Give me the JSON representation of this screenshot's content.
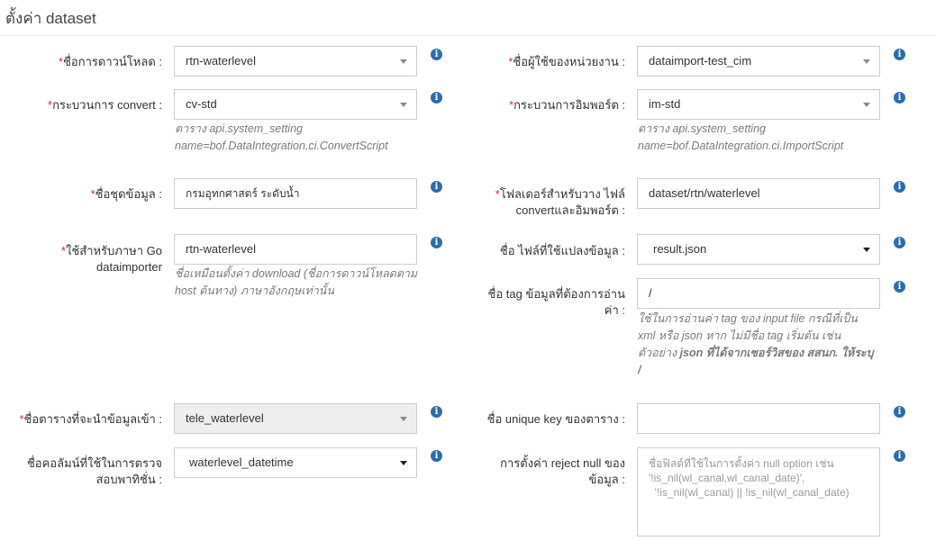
{
  "page": {
    "title": "ตั้งค่า dataset"
  },
  "left": {
    "download_name": {
      "required": "*",
      "label": "ชื่อการดาวน์โหลด :",
      "value": "rtn-waterlevel"
    },
    "convert": {
      "required": "*",
      "label": "กระบวนการ convert :",
      "value": "cv-std",
      "help_line1": "ตาราง api.system_setting",
      "help_line2": "name=bof.DataIntegration.ci.ConvertScript"
    },
    "dataset_name": {
      "required": "*",
      "label": "ชื่อชุดข้อมูล :",
      "value": "กรมอุทกศาสตร์ ระดับน้ำ"
    },
    "go_name": {
      "required": "*",
      "label_line1": "ใช้สำหรับภาษา Go",
      "label_line2": "dataimporter",
      "value": "rtn-waterlevel",
      "help_line1": "ชื่อเหมือนตั้งค่า download (ชื่อการดาวน์โหลดตาม",
      "help_line2": "host ต้นทาง) ภาษาอังกฤษเท่านั้น"
    },
    "import_table": {
      "required": "*",
      "label": "ชื่อตารางที่จะนำข้อมูลเข้า :",
      "value": "tele_waterlevel"
    },
    "time_column": {
      "label_line1": "ชื่อคอลัมน์ที่ใช้ในการตรวจ",
      "label_line2": "สอบพาทิชั่น :",
      "value": "waterlevel_datetime"
    }
  },
  "right": {
    "agency_user": {
      "required": "*",
      "label": "ชื่อผู้ใช้ของหน่วยงาน :",
      "value": "dataimport-test_cim"
    },
    "import_process": {
      "required": "*",
      "label": "กระบวนการอิมพอร์ต :",
      "value": "im-std",
      "help_line1": "ตาราง api.system_setting",
      "help_line2": "name=bof.DataIntegration.ci.ImportScript"
    },
    "folder": {
      "required": "*",
      "label_line1": "โฟลเดอร์สำหรับวาง ไฟล์",
      "label_line2": "convertและอิมพอร์ต :",
      "value": "dataset/rtn/waterlevel"
    },
    "convert_file": {
      "label": "ชื่อ ไฟล์ที่ใช้แปลงข้อมูล :",
      "value": "result.json"
    },
    "tag_name": {
      "label_line1": "ชื่อ tag ข้อมูลที่ต้องการอ่าน",
      "label_line2": "ค่า :",
      "value": "/",
      "help_line1": "ใช้ในการอ่านค่า tag ของ input file กรณีที่เป็น",
      "help_line2": "xml หรือ json หาก ไม่มีชื่อ tag เริ่มต้น เช่น",
      "help_line3_plain": "ตัวอย่าง ",
      "help_line3_bold": "json ที่ได้จากเซอร์วิสของ สสนก. ให้ระบุ",
      "help_line4_bold": "/"
    },
    "unique_key": {
      "label": "ชื่อ unique key ของตาราง :",
      "value": ""
    },
    "reject_null": {
      "label_line1": "การตั้งค่า reject null ของ",
      "label_line2": "ข้อมูล :",
      "placeholder_line1": "ชื่อฟิลด์ที่ใช้ในการตั้งค่า null option เช่น",
      "placeholder_line2": "'!is_nil(wl_canal,wl_canal_date)',",
      "placeholder_line3": "  '!is_nil(wl_canal) || !is_nil(wl_canal_date)"
    }
  },
  "icons": {
    "info": "i"
  },
  "colors": {
    "required": "#d9292c",
    "info": "#2b6cb0",
    "help_text": "#7a7a7a",
    "disabled_bg": "#eeeeee"
  }
}
